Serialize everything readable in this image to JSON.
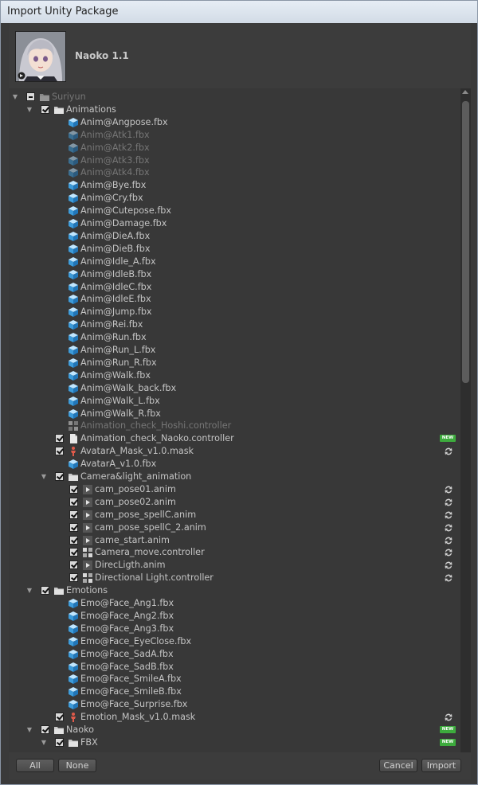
{
  "window": {
    "title": "Import Unity Package"
  },
  "package": {
    "name": "Naoko 1.1"
  },
  "buttons": {
    "all": "All",
    "none": "None",
    "cancel": "Cancel",
    "import": "Import"
  },
  "tree": [
    {
      "label": "Suriyun",
      "depth": 0,
      "kind": "folder",
      "arrow": true,
      "check": "mixed",
      "disabled": true,
      "badge": ""
    },
    {
      "label": "Animations",
      "depth": 1,
      "kind": "folder",
      "arrow": true,
      "check": "checked",
      "disabled": false,
      "badge": ""
    },
    {
      "label": "Anim@Angpose.fbx",
      "depth": 2,
      "kind": "fbx",
      "arrow": false,
      "check": "none",
      "disabled": false,
      "badge": ""
    },
    {
      "label": "Anim@Atk1.fbx",
      "depth": 2,
      "kind": "fbx",
      "arrow": false,
      "check": "none",
      "disabled": true,
      "badge": ""
    },
    {
      "label": "Anim@Atk2.fbx",
      "depth": 2,
      "kind": "fbx",
      "arrow": false,
      "check": "none",
      "disabled": true,
      "badge": ""
    },
    {
      "label": "Anim@Atk3.fbx",
      "depth": 2,
      "kind": "fbx",
      "arrow": false,
      "check": "none",
      "disabled": true,
      "badge": ""
    },
    {
      "label": "Anim@Atk4.fbx",
      "depth": 2,
      "kind": "fbx",
      "arrow": false,
      "check": "none",
      "disabled": true,
      "badge": ""
    },
    {
      "label": "Anim@Bye.fbx",
      "depth": 2,
      "kind": "fbx",
      "arrow": false,
      "check": "none",
      "disabled": false,
      "badge": ""
    },
    {
      "label": "Anim@Cry.fbx",
      "depth": 2,
      "kind": "fbx",
      "arrow": false,
      "check": "none",
      "disabled": false,
      "badge": ""
    },
    {
      "label": "Anim@Cutepose.fbx",
      "depth": 2,
      "kind": "fbx",
      "arrow": false,
      "check": "none",
      "disabled": false,
      "badge": ""
    },
    {
      "label": "Anim@Damage.fbx",
      "depth": 2,
      "kind": "fbx",
      "arrow": false,
      "check": "none",
      "disabled": false,
      "badge": ""
    },
    {
      "label": "Anim@DieA.fbx",
      "depth": 2,
      "kind": "fbx",
      "arrow": false,
      "check": "none",
      "disabled": false,
      "badge": ""
    },
    {
      "label": "Anim@DieB.fbx",
      "depth": 2,
      "kind": "fbx",
      "arrow": false,
      "check": "none",
      "disabled": false,
      "badge": ""
    },
    {
      "label": "Anim@Idle_A.fbx",
      "depth": 2,
      "kind": "fbx",
      "arrow": false,
      "check": "none",
      "disabled": false,
      "badge": ""
    },
    {
      "label": "Anim@IdleB.fbx",
      "depth": 2,
      "kind": "fbx",
      "arrow": false,
      "check": "none",
      "disabled": false,
      "badge": ""
    },
    {
      "label": "Anim@IdleC.fbx",
      "depth": 2,
      "kind": "fbx",
      "arrow": false,
      "check": "none",
      "disabled": false,
      "badge": ""
    },
    {
      "label": "Anim@IdleE.fbx",
      "depth": 2,
      "kind": "fbx",
      "arrow": false,
      "check": "none",
      "disabled": false,
      "badge": ""
    },
    {
      "label": "Anim@Jump.fbx",
      "depth": 2,
      "kind": "fbx",
      "arrow": false,
      "check": "none",
      "disabled": false,
      "badge": ""
    },
    {
      "label": "Anim@Rei.fbx",
      "depth": 2,
      "kind": "fbx",
      "arrow": false,
      "check": "none",
      "disabled": false,
      "badge": ""
    },
    {
      "label": "Anim@Run.fbx",
      "depth": 2,
      "kind": "fbx",
      "arrow": false,
      "check": "none",
      "disabled": false,
      "badge": ""
    },
    {
      "label": "Anim@Run_L.fbx",
      "depth": 2,
      "kind": "fbx",
      "arrow": false,
      "check": "none",
      "disabled": false,
      "badge": ""
    },
    {
      "label": "Anim@Run_R.fbx",
      "depth": 2,
      "kind": "fbx",
      "arrow": false,
      "check": "none",
      "disabled": false,
      "badge": ""
    },
    {
      "label": "Anim@Walk.fbx",
      "depth": 2,
      "kind": "fbx",
      "arrow": false,
      "check": "none",
      "disabled": false,
      "badge": ""
    },
    {
      "label": "Anim@Walk_back.fbx",
      "depth": 2,
      "kind": "fbx",
      "arrow": false,
      "check": "none",
      "disabled": false,
      "badge": ""
    },
    {
      "label": "Anim@Walk_L.fbx",
      "depth": 2,
      "kind": "fbx",
      "arrow": false,
      "check": "none",
      "disabled": false,
      "badge": ""
    },
    {
      "label": "Anim@Walk_R.fbx",
      "depth": 2,
      "kind": "fbx",
      "arrow": false,
      "check": "none",
      "disabled": false,
      "badge": ""
    },
    {
      "label": "Animation_check_Hoshi.controller",
      "depth": 2,
      "kind": "controller",
      "arrow": false,
      "check": "none",
      "disabled": true,
      "badge": ""
    },
    {
      "label": "Animation_check_Naoko.controller",
      "depth": 2,
      "kind": "file",
      "arrow": false,
      "check": "checked",
      "disabled": false,
      "badge": "new"
    },
    {
      "label": "AvatarA_Mask_v1.0.mask",
      "depth": 2,
      "kind": "mask",
      "arrow": false,
      "check": "checked",
      "disabled": false,
      "badge": "change"
    },
    {
      "label": "AvatarA_v1.0.fbx",
      "depth": 2,
      "kind": "fbx",
      "arrow": false,
      "check": "none",
      "disabled": false,
      "badge": ""
    },
    {
      "label": "Camera&light_animation",
      "depth": 2,
      "kind": "folder",
      "arrow": true,
      "check": "checked",
      "disabled": false,
      "badge": ""
    },
    {
      "label": "cam_pose01.anim",
      "depth": 3,
      "kind": "anim",
      "arrow": false,
      "check": "checked",
      "disabled": false,
      "badge": "change"
    },
    {
      "label": "cam_pose02.anim",
      "depth": 3,
      "kind": "anim",
      "arrow": false,
      "check": "checked",
      "disabled": false,
      "badge": "change"
    },
    {
      "label": "cam_pose_spellC.anim",
      "depth": 3,
      "kind": "anim",
      "arrow": false,
      "check": "checked",
      "disabled": false,
      "badge": "change"
    },
    {
      "label": "cam_pose_spellC_2.anim",
      "depth": 3,
      "kind": "anim",
      "arrow": false,
      "check": "checked",
      "disabled": false,
      "badge": "change"
    },
    {
      "label": "came_start.anim",
      "depth": 3,
      "kind": "anim",
      "arrow": false,
      "check": "checked",
      "disabled": false,
      "badge": "change"
    },
    {
      "label": "Camera_move.controller",
      "depth": 3,
      "kind": "controller",
      "arrow": false,
      "check": "checked",
      "disabled": false,
      "badge": "change"
    },
    {
      "label": "DirecLigth.anim",
      "depth": 3,
      "kind": "anim",
      "arrow": false,
      "check": "checked",
      "disabled": false,
      "badge": "change"
    },
    {
      "label": "Directional Light.controller",
      "depth": 3,
      "kind": "controller",
      "arrow": false,
      "check": "checked",
      "disabled": false,
      "badge": "change"
    },
    {
      "label": "Emotions",
      "depth": 1,
      "kind": "folder",
      "arrow": true,
      "check": "checked",
      "disabled": false,
      "badge": ""
    },
    {
      "label": "Emo@Face_Ang1.fbx",
      "depth": 2,
      "kind": "fbx",
      "arrow": false,
      "check": "none",
      "disabled": false,
      "badge": ""
    },
    {
      "label": "Emo@Face_Ang2.fbx",
      "depth": 2,
      "kind": "fbx",
      "arrow": false,
      "check": "none",
      "disabled": false,
      "badge": ""
    },
    {
      "label": "Emo@Face_Ang3.fbx",
      "depth": 2,
      "kind": "fbx",
      "arrow": false,
      "check": "none",
      "disabled": false,
      "badge": ""
    },
    {
      "label": "Emo@Face_EyeClose.fbx",
      "depth": 2,
      "kind": "fbx",
      "arrow": false,
      "check": "none",
      "disabled": false,
      "badge": ""
    },
    {
      "label": "Emo@Face_SadA.fbx",
      "depth": 2,
      "kind": "fbx",
      "arrow": false,
      "check": "none",
      "disabled": false,
      "badge": ""
    },
    {
      "label": "Emo@Face_SadB.fbx",
      "depth": 2,
      "kind": "fbx",
      "arrow": false,
      "check": "none",
      "disabled": false,
      "badge": ""
    },
    {
      "label": "Emo@Face_SmileA.fbx",
      "depth": 2,
      "kind": "fbx",
      "arrow": false,
      "check": "none",
      "disabled": false,
      "badge": ""
    },
    {
      "label": "Emo@Face_SmileB.fbx",
      "depth": 2,
      "kind": "fbx",
      "arrow": false,
      "check": "none",
      "disabled": false,
      "badge": ""
    },
    {
      "label": "Emo@Face_Surprise.fbx",
      "depth": 2,
      "kind": "fbx",
      "arrow": false,
      "check": "none",
      "disabled": false,
      "badge": ""
    },
    {
      "label": "Emotion_Mask_v1.0.mask",
      "depth": 2,
      "kind": "mask",
      "arrow": false,
      "check": "checked",
      "disabled": false,
      "badge": "change"
    },
    {
      "label": "Naoko",
      "depth": 1,
      "kind": "folder",
      "arrow": true,
      "check": "checked",
      "disabled": false,
      "badge": "new"
    },
    {
      "label": "FBX",
      "depth": 2,
      "kind": "folder",
      "arrow": true,
      "check": "checked",
      "disabled": false,
      "badge": "new"
    }
  ]
}
